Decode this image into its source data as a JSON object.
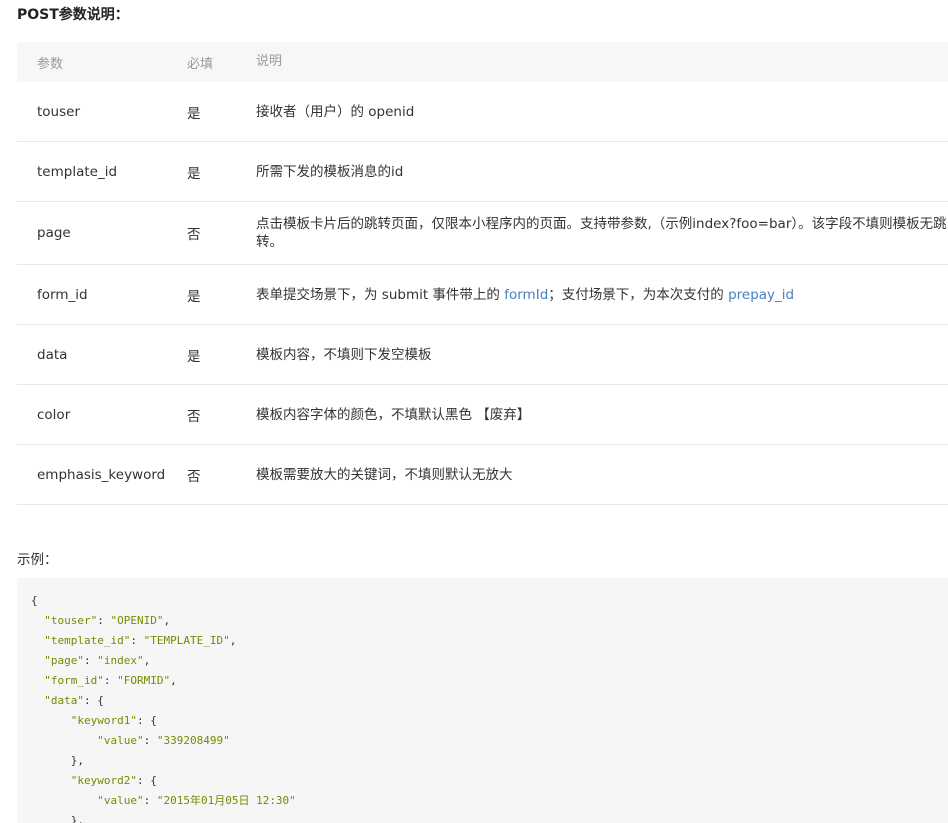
{
  "section_title": "POST参数说明：",
  "table": {
    "headers": [
      "参数",
      "必填",
      "说明"
    ],
    "rows": [
      {
        "name": "touser",
        "required": "是",
        "desc": "接收者（用户）的 openid"
      },
      {
        "name": "template_id",
        "required": "是",
        "desc": "所需下发的模板消息的id"
      },
      {
        "name": "page",
        "required": "否",
        "desc": "点击模板卡片后的跳转页面，仅限本小程序内的页面。支持带参数,（示例index?foo=bar）。该字段不填则模板无跳转。"
      },
      {
        "name": "form_id",
        "required": "是",
        "desc_parts": [
          "表单提交场景下，为 submit 事件带上的 ",
          "formId",
          "；支付场景下，为本次支付的 ",
          "prepay_id"
        ]
      },
      {
        "name": "data",
        "required": "是",
        "desc": "模板内容，不填则下发空模板"
      },
      {
        "name": "color",
        "required": "否",
        "desc": "模板内容字体的颜色，不填默认黑色 【废弃】"
      },
      {
        "name": "emphasis_keyword",
        "required": "否",
        "desc": "模板需要放大的关键词，不填则默认无放大"
      }
    ]
  },
  "example_label": "示例：",
  "code_lines": [
    "{",
    "  \"touser\": \"OPENID\",",
    "  \"template_id\": \"TEMPLATE_ID\",",
    "  \"page\": \"index\",",
    "  \"form_id\": \"FORMID\",",
    "  \"data\": {",
    "      \"keyword1\": {",
    "          \"value\": \"339208499\"",
    "      },",
    "      \"keyword2\": {",
    "          \"value\": \"2015年01月05日 12:30\"",
    "      },"
  ],
  "colors": {
    "link": "#4a7ec4",
    "code_string": "#718c00",
    "header_bg": "#f7f7f7",
    "code_bg": "#f6f6f6"
  }
}
